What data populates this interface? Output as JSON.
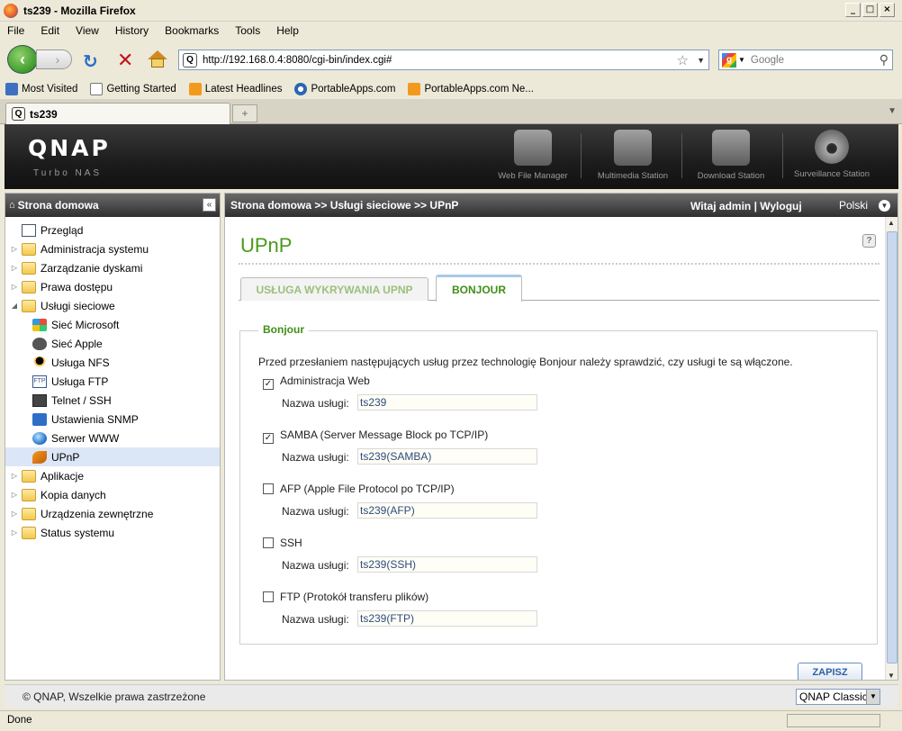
{
  "window": {
    "title": "ts239 - Mozilla Firefox"
  },
  "menubar": [
    "File",
    "Edit",
    "View",
    "History",
    "Bookmarks",
    "Tools",
    "Help"
  ],
  "navbar": {
    "url": "http://192.168.0.4:8080/cgi-bin/index.cgi#",
    "search_placeholder": "Google"
  },
  "bookmarks": [
    {
      "label": "Most Visited",
      "icon": "most-visited-icon"
    },
    {
      "label": "Getting Started",
      "icon": "page-icon"
    },
    {
      "label": "Latest Headlines",
      "icon": "rss-icon"
    },
    {
      "label": "PortableApps.com",
      "icon": "portableapps-icon"
    },
    {
      "label": "PortableApps.com Ne...",
      "icon": "rss-icon"
    }
  ],
  "tab": {
    "title": "ts239"
  },
  "header": {
    "logo": "QNAP",
    "subtitle": "Turbo NAS",
    "apps": [
      "Web File Manager",
      "Multimedia Station",
      "Download Station",
      "Surveillance Station"
    ]
  },
  "sidebar": {
    "title": "Strona domowa",
    "items": [
      {
        "label": "Przegląd"
      },
      {
        "label": "Administracja systemu"
      },
      {
        "label": "Zarządzanie dyskami"
      },
      {
        "label": "Prawa dostępu"
      },
      {
        "label": "Usługi sieciowe"
      },
      {
        "label": "Sieć Microsoft"
      },
      {
        "label": "Sieć Apple"
      },
      {
        "label": "Usługa NFS"
      },
      {
        "label": "Usługa FTP"
      },
      {
        "label": "Telnet / SSH"
      },
      {
        "label": "Ustawienia SNMP"
      },
      {
        "label": "Serwer WWW"
      },
      {
        "label": "UPnP"
      },
      {
        "label": "Aplikacje"
      },
      {
        "label": "Kopia danych"
      },
      {
        "label": "Urządzenia zewnętrzne"
      },
      {
        "label": "Status systemu"
      }
    ]
  },
  "main": {
    "breadcrumb": "Strona domowa >> Usługi sieciowe >> UPnP",
    "user_links": "Witaj admin | Wyloguj",
    "language": "Polski",
    "page_title": "UPnP",
    "tabs": [
      "USŁUGA WYKRYWANIA UPNP",
      "BONJOUR"
    ],
    "fieldset_legend": "Bonjour",
    "intro": "Przed przesłaniem następujących usług przez technologię Bonjour należy sprawdzić, czy usługi te są włączone.",
    "name_label": "Nazwa usługi:",
    "services": [
      {
        "label": "Administracja Web",
        "checked": true,
        "name": "ts239"
      },
      {
        "label": "SAMBA (Server Message Block po TCP/IP)",
        "checked": true,
        "name": "ts239(SAMBA)"
      },
      {
        "label": "AFP (Apple File Protocol po TCP/IP)",
        "checked": false,
        "name": "ts239(AFP)"
      },
      {
        "label": "SSH",
        "checked": false,
        "name": "ts239(SSH)"
      },
      {
        "label": "FTP (Protokół transferu plików)",
        "checked": false,
        "name": "ts239(FTP)"
      }
    ],
    "save_label": "ZAPISZ"
  },
  "footer": {
    "copyright": "© QNAP, Wszelkie prawa zastrzeżone",
    "theme": "QNAP Classic"
  },
  "status": {
    "text": "Done"
  }
}
